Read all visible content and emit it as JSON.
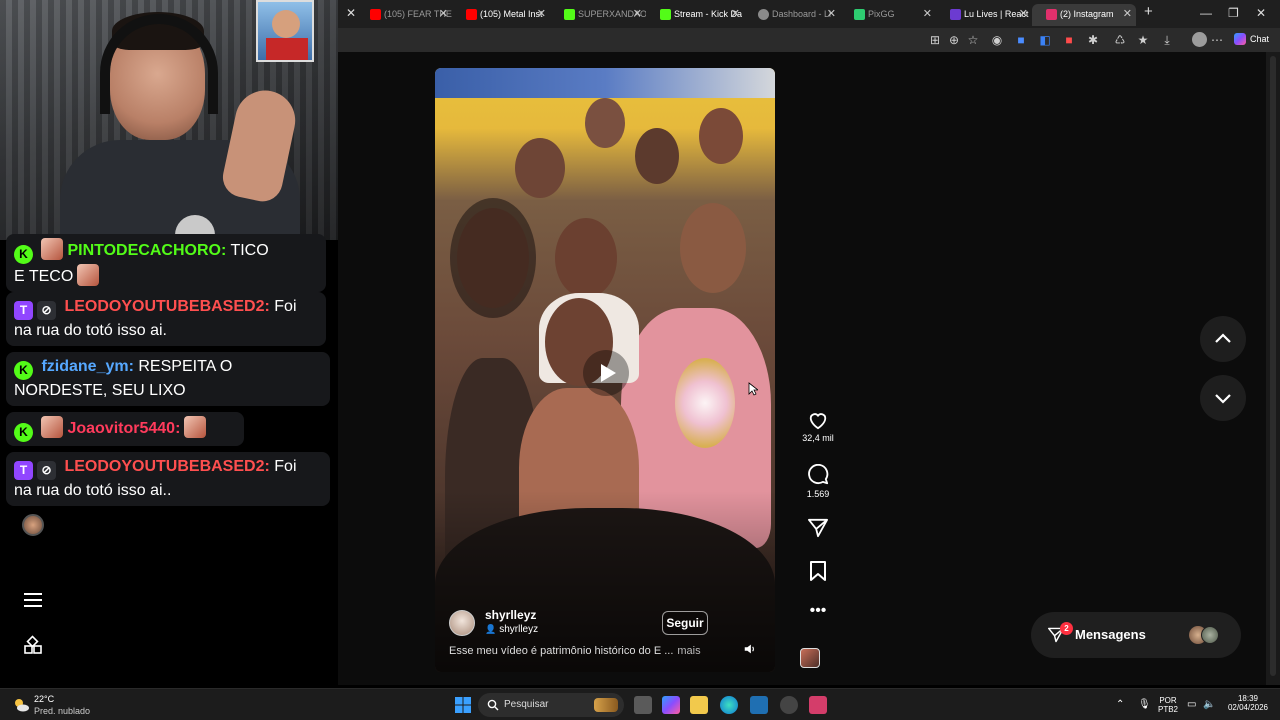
{
  "browser": {
    "tabs": [
      {
        "title": "(105) FEAR THE",
        "favicon_color": "#ff0000"
      },
      {
        "title": "(105) Metal Inst",
        "favicon_color": "#ff0000"
      },
      {
        "title": "SUPERXANDAO",
        "favicon_color": "#53fc18"
      },
      {
        "title": "Stream - Kick Da",
        "favicon_color": "#53fc18"
      },
      {
        "title": "Dashboard - Li",
        "favicon_color": "#8a8a8a"
      },
      {
        "title": "PixGG",
        "favicon_color": "#2ecc71"
      },
      {
        "title": "Lu Lives | React",
        "favicon_color": "#6c3bd1"
      },
      {
        "title": "(2) Instagram",
        "favicon_color": "#e1306c"
      }
    ],
    "new_tab": "+",
    "toolbar_chat": "Chat"
  },
  "chat": {
    "messages": [
      {
        "badge": "K",
        "user": "PINTODECACHORO:",
        "user_color": "#53fc18",
        "text": "TICO",
        "continued": "E TECO"
      },
      {
        "badge": "T",
        "user": "LEODOYOUTUBEBASED2:",
        "user_color": "#ff4f4f",
        "text": "Foi",
        "continued": "na rua do totó isso ai."
      },
      {
        "badge": "K",
        "user": "fzidane_ym:",
        "user_color": "#56a8ff",
        "text": "RESPEITA O",
        "continued": "NORDESTE, SEU LIXO"
      },
      {
        "badge": "K",
        "user": "Joaovitor5440:",
        "user_color": "#ff3b5c",
        "text": "",
        "continued": ""
      },
      {
        "badge": "T",
        "user": "LEODOYOUTUBEBASED2:",
        "user_color": "#ff4f4f",
        "text": "Foi",
        "continued": "na rua do totó isso ai.."
      }
    ]
  },
  "reel": {
    "author": "shyrlleyz",
    "author_sub": "shyrlleyz",
    "follow_label": "Seguir",
    "caption": "Esse meu vídeo é patrimônio histórico do E ...",
    "more_label": "mais",
    "likes": "32,4 mil",
    "comments": "1.569"
  },
  "messages_button": {
    "label": "Mensagens",
    "badge": "2"
  },
  "taskbar": {
    "temperature": "22°C",
    "weather": "Pred. nublado",
    "search_placeholder": "Pesquisar",
    "lang_top": "POR",
    "lang_bottom": "PTB2",
    "time": "18:39",
    "date": "02/04/2026"
  },
  "colors": {
    "kick_green": "#53fc18",
    "twitch_purple": "#9146ff",
    "instagram_notify": "#ff3040"
  }
}
